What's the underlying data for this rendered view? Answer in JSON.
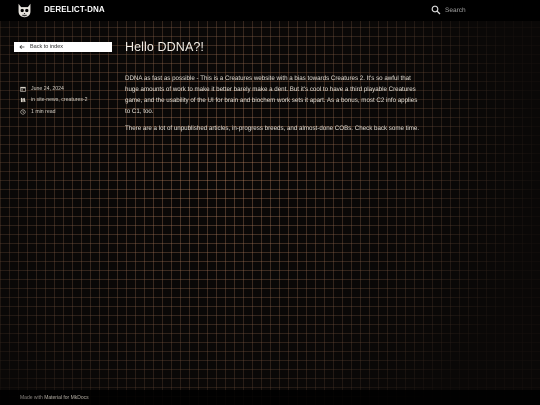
{
  "header": {
    "site_title": "DERELICT-DNA",
    "search_placeholder": "Search"
  },
  "sidebar": {
    "back_label": "Back to index",
    "date": "June 24, 2024",
    "categories_prefix": "in ",
    "category_1": "site-news",
    "category_separator": ", ",
    "category_2": "creatures-2",
    "read_time": "1 min read"
  },
  "article": {
    "title": "Hello DDNA?!",
    "paragraph_1": "DDNA as fast as possible - This is a Creatures website with a bias towards Creatures 2. It's so awful that huge amounts of work to make it better barely make a dent. But it's cool to have a third playable Creatures game, and the usability of the UI for brain and biochem work sets it apart. As a bonus, most C2 info applies to C1, too.",
    "paragraph_2": "There are a lot of unpublished articles, in-progress breeds, and almost-done COBs. Check back some time."
  },
  "footer": {
    "made_with": "Made with ",
    "framework": "Material for MkDocs"
  },
  "colors": {
    "grid": "#d2966e",
    "header_bg": "#000000",
    "page_bg": "#0a0807"
  },
  "icons": {
    "logo": "cat-skull-logo",
    "search": "search-icon",
    "back": "arrow-left-icon",
    "date": "calendar-icon",
    "categories": "bookshelf-icon",
    "read_time": "clock-icon"
  }
}
